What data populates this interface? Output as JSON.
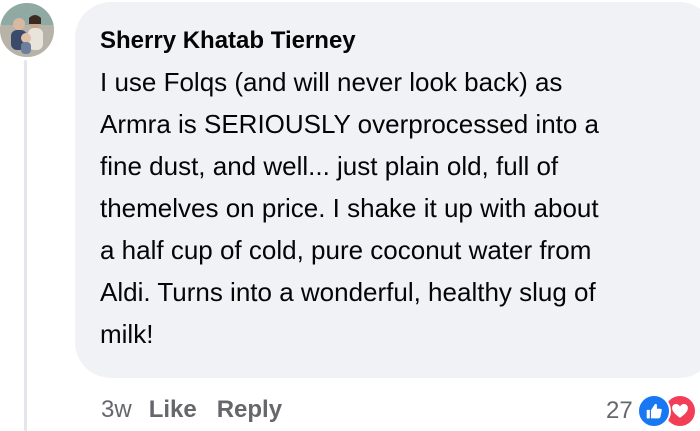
{
  "comment": {
    "author": "Sherry Khatab Tierney",
    "text_lines": [
      "I use Folqs (and will never look back) as",
      "Armra is SERIOUSLY overprocessed into a",
      "fine dust, and well... just plain old, full of",
      "themelves on price. I shake it up with about",
      "a half cup of cold, pure coconut water from",
      "Aldi. Turns into a wonderful, healthy slug of",
      "milk!"
    ],
    "timestamp": "3w",
    "like_label": "Like",
    "reply_label": "Reply",
    "reaction_count": "27",
    "reactions": [
      "like-icon",
      "love-icon"
    ]
  },
  "colors": {
    "bubble": "#f0f2f5",
    "text": "#050505",
    "meta": "#65676b",
    "like": "#1877f2",
    "love": "#f33e58"
  }
}
